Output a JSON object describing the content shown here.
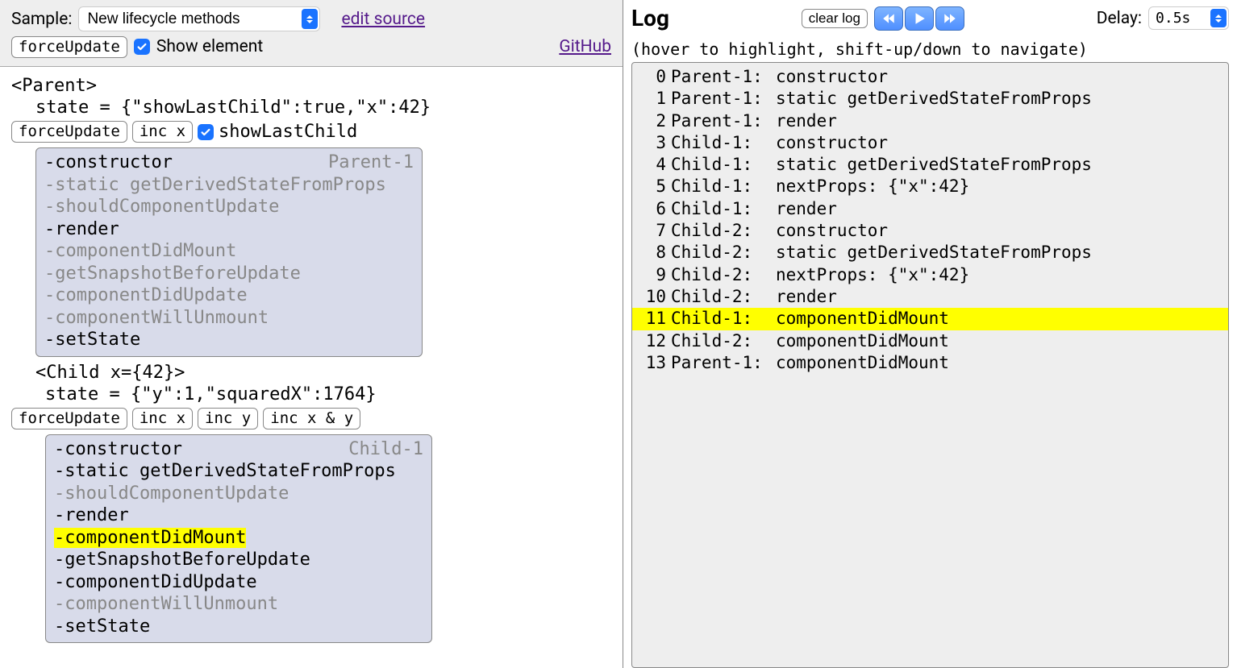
{
  "toolbar": {
    "sample_label": "Sample:",
    "sample_value": "New lifecycle methods",
    "edit_source": "edit source",
    "force_update": "forceUpdate",
    "show_element": "Show element",
    "github": "GitHub"
  },
  "tree": {
    "parent_tag": "<Parent>",
    "parent_state": "state = {\"showLastChild\":true,\"x\":42}",
    "parent_controls": {
      "force_update": "forceUpdate",
      "inc_x": "inc x",
      "show_last_child": "showLastChild"
    },
    "parent_panel": {
      "title": "Parent-1",
      "items": [
        {
          "text": "-constructor",
          "dim": false,
          "hl": false
        },
        {
          "text": "-static getDerivedStateFromProps",
          "dim": true,
          "hl": false
        },
        {
          "text": "-shouldComponentUpdate",
          "dim": true,
          "hl": false
        },
        {
          "text": "-render",
          "dim": false,
          "hl": false
        },
        {
          "text": "-componentDidMount",
          "dim": true,
          "hl": false
        },
        {
          "text": "-getSnapshotBeforeUpdate",
          "dim": true,
          "hl": false
        },
        {
          "text": "-componentDidUpdate",
          "dim": true,
          "hl": false
        },
        {
          "text": "-componentWillUnmount",
          "dim": true,
          "hl": false
        },
        {
          "text": "-setState",
          "dim": false,
          "hl": false
        }
      ]
    },
    "child_tag": "<Child x={42}>",
    "child_state": "state = {\"y\":1,\"squaredX\":1764}",
    "child_controls": {
      "force_update": "forceUpdate",
      "inc_x": "inc x",
      "inc_y": "inc y",
      "inc_xy": "inc x & y"
    },
    "child_panel": {
      "title": "Child-1",
      "items": [
        {
          "text": "-constructor",
          "dim": false,
          "hl": false
        },
        {
          "text": "-static getDerivedStateFromProps",
          "dim": false,
          "hl": false
        },
        {
          "text": "-shouldComponentUpdate",
          "dim": true,
          "hl": false
        },
        {
          "text": "-render",
          "dim": false,
          "hl": false
        },
        {
          "text": "-componentDidMount",
          "dim": false,
          "hl": true
        },
        {
          "text": "-getSnapshotBeforeUpdate",
          "dim": false,
          "hl": false
        },
        {
          "text": "-componentDidUpdate",
          "dim": false,
          "hl": false
        },
        {
          "text": "-componentWillUnmount",
          "dim": true,
          "hl": false
        },
        {
          "text": "-setState",
          "dim": false,
          "hl": false
        }
      ]
    }
  },
  "log": {
    "title": "Log",
    "clear": "clear log",
    "delay_label": "Delay:",
    "delay_value": "0.5s",
    "hint": "(hover to highlight, shift-up/down to navigate)",
    "entries": [
      {
        "n": 0,
        "comp": "Parent-1:",
        "msg": "constructor",
        "hl": false
      },
      {
        "n": 1,
        "comp": "Parent-1:",
        "msg": "static getDerivedStateFromProps",
        "hl": false
      },
      {
        "n": 2,
        "comp": "Parent-1:",
        "msg": "render",
        "hl": false
      },
      {
        "n": 3,
        "comp": "Child-1:",
        "msg": "constructor",
        "hl": false
      },
      {
        "n": 4,
        "comp": "Child-1:",
        "msg": "static getDerivedStateFromProps",
        "hl": false
      },
      {
        "n": 5,
        "comp": "Child-1:",
        "msg": "nextProps: {\"x\":42}",
        "hl": false
      },
      {
        "n": 6,
        "comp": "Child-1:",
        "msg": "render",
        "hl": false
      },
      {
        "n": 7,
        "comp": "Child-2:",
        "msg": "constructor",
        "hl": false
      },
      {
        "n": 8,
        "comp": "Child-2:",
        "msg": "static getDerivedStateFromProps",
        "hl": false
      },
      {
        "n": 9,
        "comp": "Child-2:",
        "msg": "nextProps: {\"x\":42}",
        "hl": false
      },
      {
        "n": 10,
        "comp": "Child-2:",
        "msg": "render",
        "hl": false
      },
      {
        "n": 11,
        "comp": "Child-1:",
        "msg": "componentDidMount",
        "hl": true
      },
      {
        "n": 12,
        "comp": "Child-2:",
        "msg": "componentDidMount",
        "hl": false
      },
      {
        "n": 13,
        "comp": "Parent-1:",
        "msg": "componentDidMount",
        "hl": false
      }
    ]
  }
}
